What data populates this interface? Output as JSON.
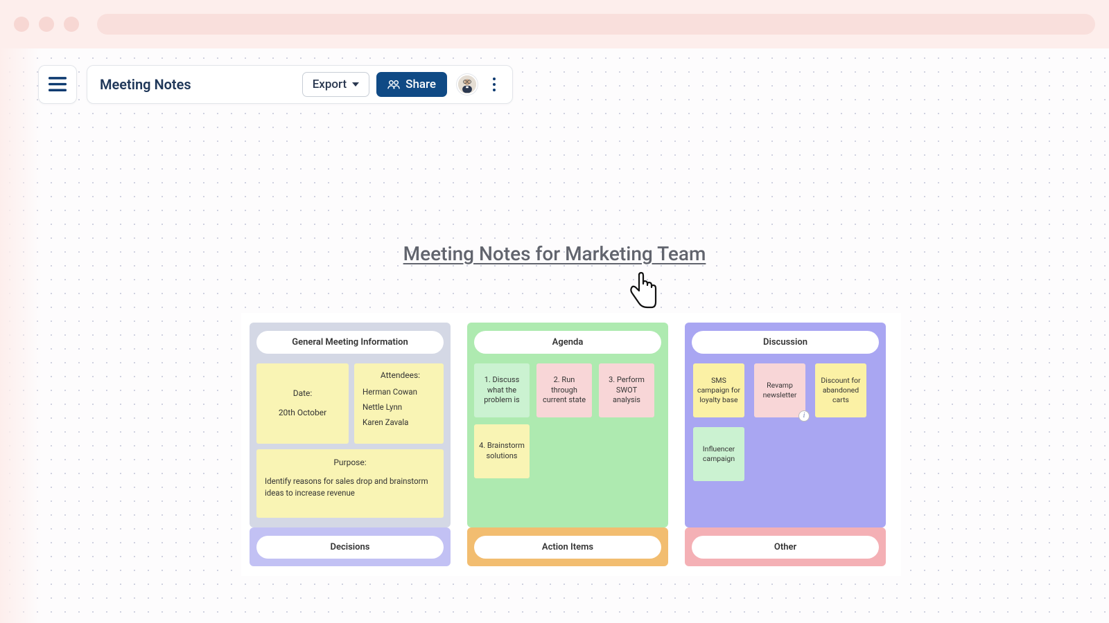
{
  "toolbar": {
    "title": "Meeting Notes",
    "export_label": "Export",
    "share_label": "Share"
  },
  "canvas": {
    "title": "Meeting Notes for Marketing Team"
  },
  "general": {
    "header": "General Meeting Information",
    "date_label": "Date:",
    "date_value": "20th October",
    "attendees_label": "Attendees:",
    "attendees": [
      "Herman Cowan",
      "Nettle Lynn",
      "Karen Zavala"
    ],
    "purpose_label": "Purpose:",
    "purpose_text": "Identify reasons for sales drop and brainstorm ideas to increase revenue"
  },
  "agenda": {
    "header": "Agenda",
    "items": [
      "1. Discuss what the problem is",
      "2. Run through current state",
      "3. Perform SWOT analysis",
      "4. Brainstorm solutions"
    ]
  },
  "discussion": {
    "header": "Discussion",
    "items": [
      "SMS campaign for loyalty base",
      "Revamp newsletter",
      "Discount for abandoned carts",
      "Influencer campaign"
    ]
  },
  "row2": {
    "decisions": "Decisions",
    "action_items": "Action Items",
    "other": "Other"
  }
}
